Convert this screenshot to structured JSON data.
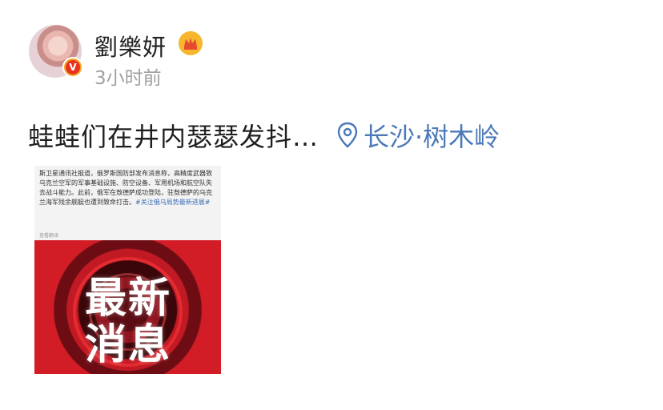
{
  "post": {
    "username": "劉樂妍",
    "timestamp": "3小时前",
    "text": "蛙蛙们在井内瑟瑟发抖…",
    "location": "长沙·树木岭",
    "badge_letter": "V"
  },
  "image": {
    "news_text": "斯卫星通讯社报道，俄罗斯国防部发布消息称，高精度武器致乌克兰空军的军事基础设施、防空设备、军用机场和航空队失去战斗能力。此前，俄军在敖德萨成功登陆，驻敖德萨的乌克兰海军残余舰艇也遭到致命打击。",
    "hashtag": "#关注俄乌局势最新进展#",
    "translate_label": "查看翻译",
    "banner_line1": "最新",
    "banner_line2": "消息"
  },
  "colors": {
    "username": "#222222",
    "timestamp": "#a0a0a0",
    "location": "#4a78b8",
    "banner_red": "#d21d27",
    "badge_orange": "#f5a623",
    "badge_red": "#e8321e"
  },
  "icons": {
    "avatar_badge": "verified-badge-icon",
    "crown": "crown-icon",
    "location": "location-pin-icon"
  }
}
